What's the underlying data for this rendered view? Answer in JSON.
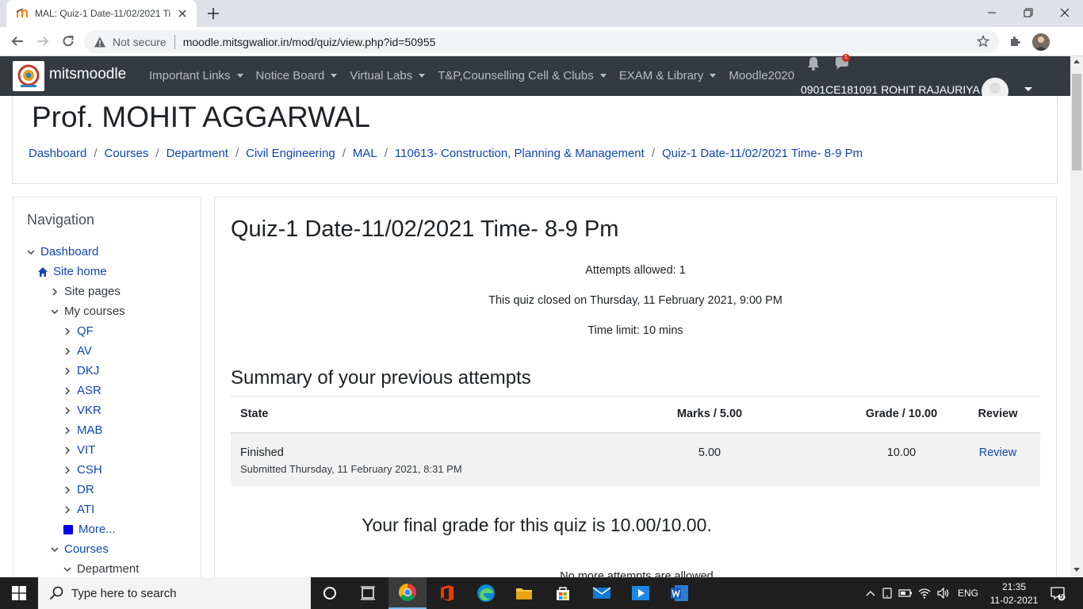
{
  "browser": {
    "tab_title": "MAL: Quiz-1 Date-11/02/2021 Ti",
    "security_label": "Not secure",
    "url": "moodle.mitsgwalior.in/mod/quiz/view.php?id=50955"
  },
  "navbar": {
    "brand": "mitsmoodle",
    "menu": [
      "Important Links",
      "Notice Board",
      "Virtual Labs",
      "T&P,Counselling Cell & Clubs",
      "EXAM & Library",
      "Moodle2020"
    ],
    "username": "0901CE181091 ROHIT RAJAURIYA",
    "message_badge": "1"
  },
  "header": {
    "title": "Prof. MOHIT AGGARWAL",
    "breadcrumb": [
      "Dashboard",
      "Courses",
      "Department",
      "Civil Engineering",
      "MAL",
      "110613- Construction, Planning & Management",
      "Quiz-1 Date-11/02/2021 Time- 8-9 Pm"
    ]
  },
  "navigation": {
    "heading": "Navigation",
    "items": [
      "Dashboard",
      "Site home",
      "Site pages",
      "My courses",
      "QF",
      "AV",
      "DKJ",
      "ASR",
      "VKR",
      "MAB",
      "VIT",
      "CSH",
      "DR",
      "ATI",
      "More...",
      "Courses",
      "Department"
    ]
  },
  "quiz": {
    "title": "Quiz-1 Date-11/02/2021 Time- 8-9 Pm",
    "attempts_allowed": "Attempts allowed: 1",
    "closed": "This quiz closed on Thursday, 11 February 2021, 9:00 PM",
    "time_limit": "Time limit: 10 mins",
    "summary_heading": "Summary of your previous attempts",
    "table_headers": [
      "State",
      "Marks / 5.00",
      "Grade / 10.00",
      "Review"
    ],
    "attempt": {
      "state": "Finished",
      "submitted": "Submitted Thursday, 11 February 2021, 8:31 PM",
      "marks": "5.00",
      "grade": "10.00",
      "review": "Review"
    },
    "final_grade": "Your final grade for this quiz is 10.00/10.00.",
    "no_more": "No more attempts are allowed"
  },
  "taskbar": {
    "search_placeholder": "Type here to search",
    "language": "ENG",
    "time": "21:35",
    "date": "11-02-2021",
    "notification_count": "5"
  },
  "colors": {
    "link": "#0f47ad",
    "navbar": "#343a40",
    "table_row": "#f2f2f2"
  }
}
